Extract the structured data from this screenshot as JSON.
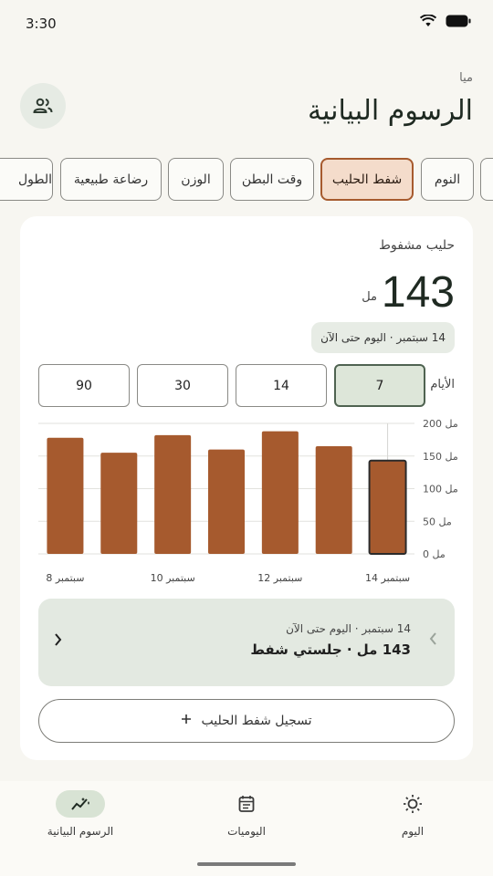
{
  "status": {
    "time": "3:30"
  },
  "header": {
    "subtitle": "ميا",
    "title": "الرسوم البيانية"
  },
  "tabs": [
    {
      "label": "النوم"
    },
    {
      "label": "شفط الحليب",
      "active": true
    },
    {
      "label": "وقت البطن"
    },
    {
      "label": "الوزن"
    },
    {
      "label": "رضاعة طبيعية"
    },
    {
      "label": "الطول"
    }
  ],
  "card": {
    "title": "حليب مشفوط",
    "value": "143",
    "unit": "مل",
    "range": "14 سبتمبر · اليوم حتى الآن",
    "days_label": "الأيام",
    "day_options": [
      "7",
      "14",
      "30",
      "90"
    ],
    "selected_days": "7"
  },
  "chart_data": {
    "type": "bar",
    "categories": [
      "8 سبتمبر",
      "9 سبتمبر",
      "10 سبتمبر",
      "11 سبتمبر",
      "12 سبتمبر",
      "13 سبتمبر",
      "14 سبتمبر"
    ],
    "values": [
      178,
      155,
      182,
      160,
      188,
      165,
      143
    ],
    "x_tick_labels": [
      "8 سبتمبر",
      "10 سبتمبر",
      "12 سبتمبر",
      "14 سبتمبر"
    ],
    "y_ticks": [
      "0 مل",
      "50 مل",
      "100 مل",
      "150 مل",
      "200 مل"
    ],
    "ylim": [
      0,
      200
    ],
    "highlighted_index": 6,
    "bar_color": "#a65a2e",
    "grid": true
  },
  "summary": {
    "line1": "14 سبتمبر · اليوم حتى الآن",
    "line2": "143 مل · جلستي شفط"
  },
  "log_button": {
    "label": "تسجيل شفط الحليب"
  },
  "nav": {
    "charts": "الرسوم البيانية",
    "journal": "اليوميات",
    "today": "اليوم"
  },
  "colors": {
    "accent": "#a65a2e",
    "background": "#f7f6f1",
    "active_green": "#d8e3d4"
  }
}
